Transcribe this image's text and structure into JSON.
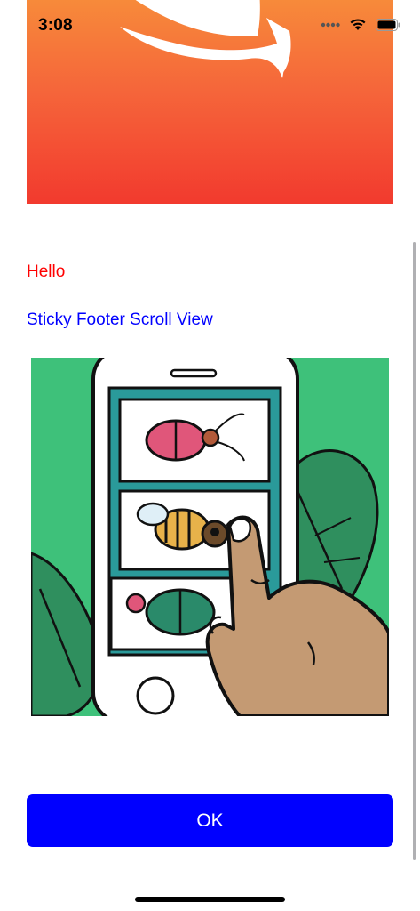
{
  "status_bar": {
    "time": "3:08"
  },
  "content": {
    "hello_text": "Hello",
    "subtitle_text": "Sticky Footer Scroll View"
  },
  "footer": {
    "ok_label": "OK"
  },
  "colors": {
    "hello": "#ff0000",
    "subtitle": "#0000ff",
    "ok_button": "#0000ff",
    "banner_top": "#f78a3a",
    "banner_bottom": "#f23a2e",
    "illustration_bg": "#3ec17a"
  },
  "icons": {
    "banner": "swift-logo-icon",
    "signal": "signal-dots-icon",
    "wifi": "wifi-icon",
    "battery": "battery-icon"
  }
}
